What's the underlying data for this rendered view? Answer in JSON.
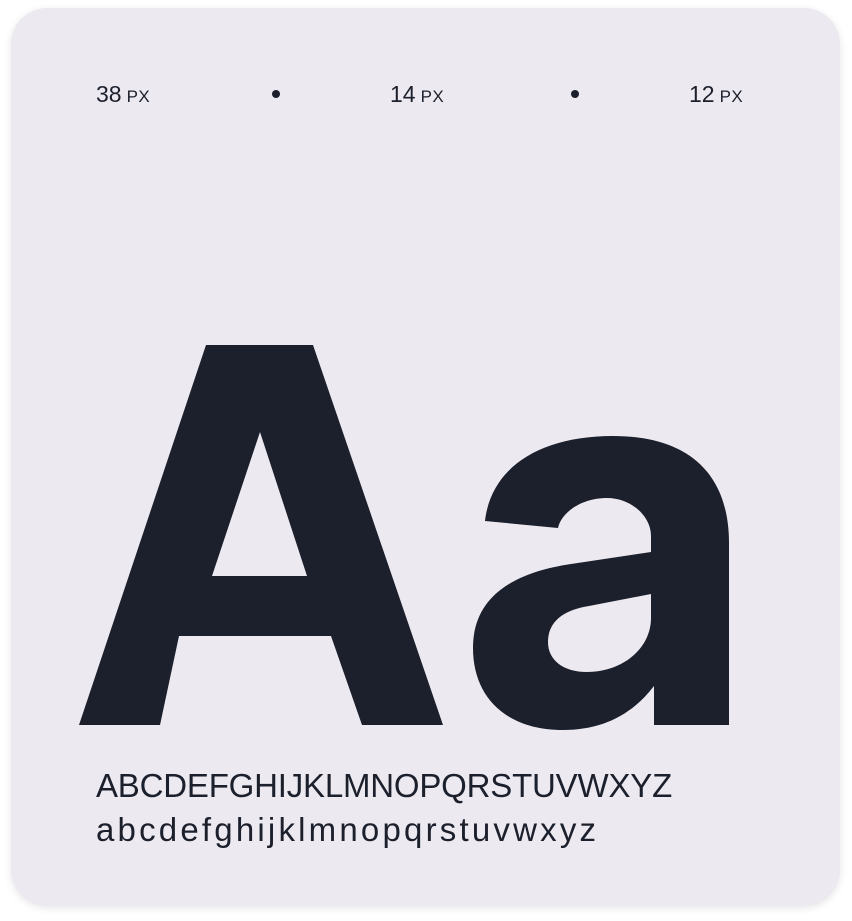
{
  "size_scale": [
    {
      "value": "38",
      "unit": "PX"
    },
    {
      "value": "14",
      "unit": "PX"
    },
    {
      "value": "12",
      "unit": "PX"
    }
  ],
  "specimen": {
    "glyphs": "Aa",
    "uppercase": "ABCDEFGHIJKLMNOPQRSTUVWXYZ",
    "lowercase": "abcdefghijklmnopqrstuvwxyz"
  },
  "colors": {
    "card_background": "#eceaf0",
    "text": "#1c1f2c"
  }
}
